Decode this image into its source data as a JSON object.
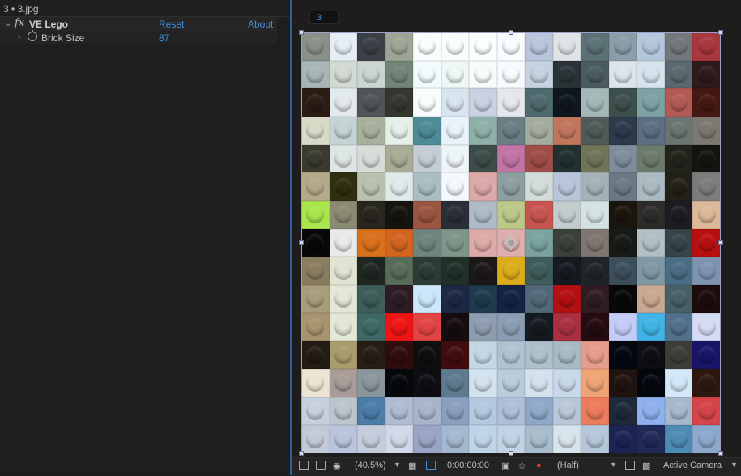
{
  "effect_controls": {
    "tab_title": "3 • 3.jpg",
    "effect": {
      "name": "VE Lego",
      "fx_symbol": "fx",
      "reset_label": "Reset",
      "about_label": "About"
    },
    "parameters": [
      {
        "name": "Brick Size",
        "value": "87"
      }
    ]
  },
  "viewer": {
    "frame_field_value": "3",
    "bottom_bar": {
      "zoom": "(40.5%)",
      "timecode": "0:00:00:00",
      "resolution": "(Half)",
      "camera": "Active Camera"
    }
  },
  "mosaic": {
    "columns": 15,
    "rows": 15,
    "colors": [
      "#8a8f8a",
      "#e5eef4",
      "#3a4046",
      "#9ea596",
      "#f9fdfd",
      "#f8fdfe",
      "#fafeff",
      "#f8fcfe",
      "#b8c6dc",
      "#dfe3e6",
      "#5a7276",
      "#8a9da8",
      "#b4c6dc",
      "#72777c",
      "#a9373e",
      "#a8b6b6",
      "#d2dad4",
      "#cbd4d0",
      "#728476",
      "#f2fbfb",
      "#eef7f6",
      "#f6fbfc",
      "#f8fbfd",
      "#c5d2e0",
      "#2a3438",
      "#4a5c60",
      "#dce4ec",
      "#d6e2ec",
      "#5c6870",
      "#2e1a1a",
      "#2b1c14",
      "#e2e9ec",
      "#4f5458",
      "#34372e",
      "#f8fcfd",
      "#d8e4ee",
      "#c8d2e2",
      "#e4e8ec",
      "#4e6a6e",
      "#10161e",
      "#a4b8b8",
      "#3e504c",
      "#7ea2a4",
      "#b45a54",
      "#451814",
      "#d8d9c6",
      "#c4d3d4",
      "#a8b09c",
      "#e4efe9",
      "#4d8c96",
      "#e8f2fa",
      "#8eb0a8",
      "#6a7e84",
      "#a4aca0",
      "#c0765c",
      "#4e5a58",
      "#2c3a4c",
      "#5c6e84",
      "#6a7470",
      "#7a7870",
      "#3a3a2e",
      "#dde6e4",
      "#d6dcd8",
      "#a8ac94",
      "#c4ccd6",
      "#edf5f9",
      "#3c4c48",
      "#c274a4",
      "#a04c48",
      "#223030",
      "#727458",
      "#7e8c9c",
      "#6c7a6c",
      "#22241c",
      "#121410",
      "#b4aa8a",
      "#2e2e10",
      "#b8c0b0",
      "#e0eaea",
      "#aabec2",
      "#f2f8fc",
      "#dca8a8",
      "#8c9ea0",
      "#d2dcda",
      "#b8c4d8",
      "#a4b2b8",
      "#6c7884",
      "#aabac0",
      "#222018",
      "#7c7c7c",
      "#a8e64c",
      "#8a8a72",
      "#28261e",
      "#16140e",
      "#9a5440",
      "#2a2e36",
      "#aebac6",
      "#bcc888",
      "#c85450",
      "#c2cccc",
      "#d4e2e4",
      "#1a160e",
      "#2e2c2a",
      "#1c1c22",
      "#dcb898",
      "#08080a",
      "#e8eae8",
      "#d8701c",
      "#d26420",
      "#6e847c",
      "#7e9688",
      "#dcaaa8",
      "#dcaeac",
      "#7aa2a0",
      "#384038",
      "#7e7670",
      "#181a18",
      "#b2c0c4",
      "#364448",
      "#b81010",
      "#8a7c5e",
      "#e2e4d2",
      "#1e2622",
      "#566c58",
      "#2c3c34",
      "#203028",
      "#1c1818",
      "#dcac18",
      "#3e5c5a",
      "#141a20",
      "#1e2428",
      "#3c4e5c",
      "#7e98a4",
      "#4a6c84",
      "#7c94b0",
      "#a89c7a",
      "#e4e6d8",
      "#3e5c58",
      "#2e1c24",
      "#cce6fa",
      "#1e2844",
      "#1e3a4c",
      "#162244",
      "#526878",
      "#b41014",
      "#301c24",
      "#08080a",
      "#c8a890",
      "#486068",
      "#1c0c0e",
      "#a8946e",
      "#e4e6d6",
      "#3e6864",
      "#f01414",
      "#e24444",
      "#140c0e",
      "#8e9cb0",
      "#8a9cb2",
      "#141a20",
      "#a83040",
      "#240c10",
      "#c2ccf8",
      "#40b4e6",
      "#50708c",
      "#d4dcf4",
      "#221c12",
      "#a89c6c",
      "#261e16",
      "#300c0e",
      "#0e0e0e",
      "#400c10",
      "#c4d6e4",
      "#b0c2d2",
      "#aec0cc",
      "#a8bac4",
      "#e69c8c",
      "#040810",
      "#0c0e14",
      "#3c3c38",
      "#181468",
      "#ece4d2",
      "#a89c98",
      "#8a969c",
      "#06080c",
      "#0e0e12",
      "#5e7a8e",
      "#d2e2ee",
      "#b8ccdc",
      "#d4e2ee",
      "#c8d8e8",
      "#f0a474",
      "#201410",
      "#04080e",
      "#d2e8f8",
      "#2c180e",
      "#c6d0dc",
      "#bcc4cc",
      "#4c7ca8",
      "#b0bcd0",
      "#a8b4cc",
      "#88a0be",
      "#b4c8e0",
      "#aec0d8",
      "#90a8c8",
      "#b8c8d8",
      "#ec7c5c",
      "#1e2a3a",
      "#8eb0ec",
      "#a8b8cc",
      "#d44448",
      "#c2cad8",
      "#b8c4dc",
      "#c4ccdc",
      "#d2d8e8",
      "#9aa4c4",
      "#a4b8d0",
      "#c0d4e8",
      "#c0d2e4",
      "#a8bccc",
      "#d8e4ec",
      "#b4c6d8",
      "#1c2454",
      "#202a58",
      "#4c8cb4",
      "#8ca8cc"
    ]
  }
}
